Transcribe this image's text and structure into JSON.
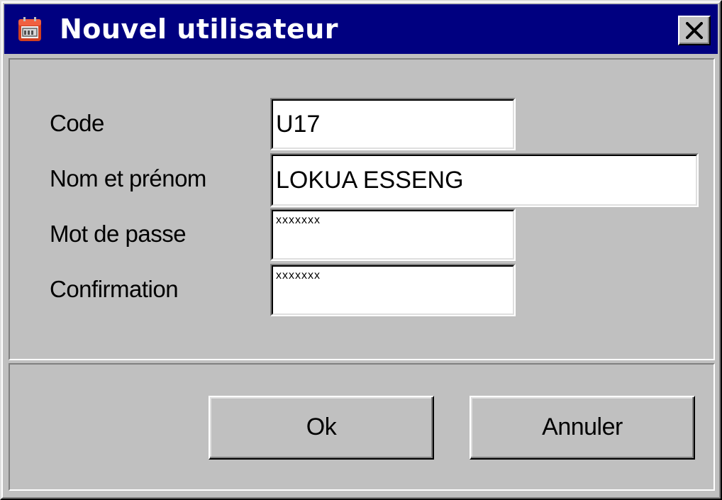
{
  "window": {
    "title": "Nouvel utilisateur",
    "close_label": "X",
    "icon": "calendar-icon",
    "titlebar_color": "#000080",
    "face_color": "#c0c0c0"
  },
  "form": {
    "code": {
      "label": "Code",
      "value": "U17"
    },
    "name": {
      "label": "Nom et prénom",
      "value": "LOKUA ESSENG"
    },
    "password": {
      "label": "Mot de passe",
      "value": "xxxxxxx"
    },
    "confirmation": {
      "label": "Confirmation",
      "value": "xxxxxxx"
    }
  },
  "buttons": {
    "ok_label": "Ok",
    "cancel_label": "Annuler"
  }
}
